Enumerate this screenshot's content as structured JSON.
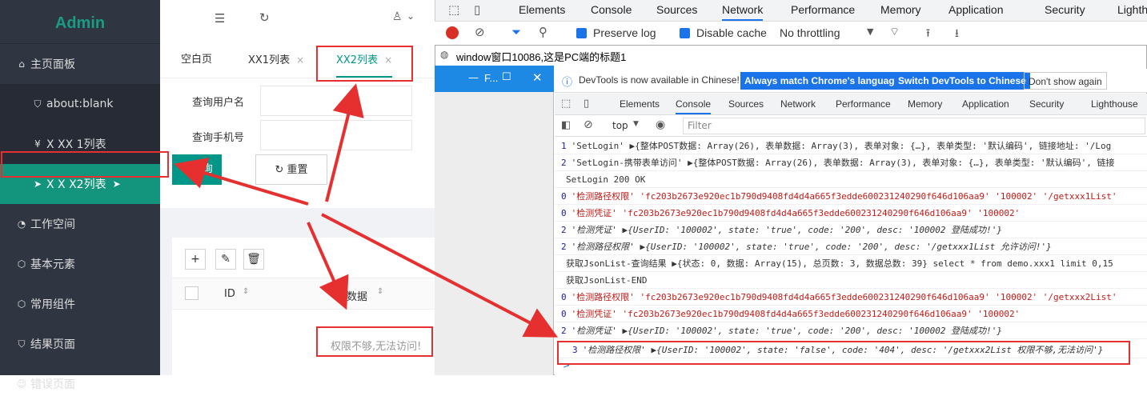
{
  "admin": {
    "brand": "Admin",
    "nav": [
      {
        "label": "主页面板",
        "icon": "home-icon"
      },
      {
        "label": "about:blank",
        "icon": "shield-icon"
      },
      {
        "label": "X XX 1列表",
        "icon": "yen-icon"
      },
      {
        "label": "X X X2列表",
        "icon": "send-icon",
        "active": true
      },
      {
        "label": "工作空间",
        "icon": "dashboard-icon"
      },
      {
        "label": "基本元素",
        "icon": "cube-icon"
      },
      {
        "label": "常用组件",
        "icon": "cube-icon"
      },
      {
        "label": "结果页面",
        "icon": "check-shield-icon"
      },
      {
        "label": "错误页面",
        "icon": "face-icon"
      }
    ],
    "tabs": [
      {
        "label": "空白页"
      },
      {
        "label": "XX1列表",
        "close": "×"
      },
      {
        "label": "XX2列表",
        "close": "×",
        "active": true
      }
    ],
    "form": {
      "user_label": "查询用户名",
      "phone_label": "查询手机号",
      "search_button": "查询",
      "reset_button": "重置"
    },
    "table": {
      "col_id": "ID",
      "col_data": "数据",
      "empty_message": "权限不够,无法访问!"
    },
    "accent": "#009688"
  },
  "devtools": {
    "tabs": [
      "Elements",
      "Console",
      "Sources",
      "Network",
      "Performance",
      "Memory",
      "Application",
      "Security",
      "Lighthouse"
    ],
    "active_tab": "Network",
    "network_toolbar": {
      "preserve_log": "Preserve log",
      "disable_cache": "Disable cache",
      "throttling": "No throttling"
    }
  },
  "popup": {
    "title": "window窗口10086,这是PC端的标题1",
    "left_window_title": "F...",
    "info_text": "DevTools is now available in Chinese!",
    "btn_match": "Always match Chrome's language",
    "btn_switch": "Switch DevTools to Chinese",
    "btn_dont_show": "Don't show again",
    "tabs": [
      "Elements",
      "Console",
      "Sources",
      "Network",
      "Performance",
      "Memory",
      "Application",
      "Security",
      "Lighthouse"
    ],
    "active_tab": "Console",
    "context": "top",
    "filter_placeholder": "Filter",
    "console_lines": [
      {
        "count": "1",
        "text": "'SetLogin' ▶{整体POST数据: Array(26), 表单数据: Array(3), 表单对象: {…}, 表单类型: '默认编码', 链接地址: '/Log"
      },
      {
        "count": "2",
        "text": "'SetLogin-携带表单访问' ▶{整体POST数据: Array(26), 表单数据: Array(3), 表单对象: {…}, 表单类型: '默认编码', 链接"
      },
      {
        "count": "",
        "text": "SetLogin 200 OK"
      },
      {
        "count": "0",
        "text": "'检测路径权限' 'fc203b2673e920ec1b790d9408fd4d4a665f3edde600231240290f646d106aa9' '100002' '/getxxx1List'"
      },
      {
        "count": "0",
        "text": "'检测凭证' 'fc203b2673e920ec1b790d9408fd4d4a665f3edde600231240290f646d106aa9' '100002'"
      },
      {
        "count": "2",
        "text": "'检测凭证' ▶{UserID: '100002', state: 'true', code: '200', desc: '100002 登陆成功!'}"
      },
      {
        "count": "2",
        "text": "'检测路径权限' ▶{UserID: '100002', state: 'true', code: '200', desc: '/getxxx1List 允许访问!'}"
      },
      {
        "count": "",
        "text": "获取JsonList-查询结果 ▶{状态: 0, 数据: Array(15), 总页数: 3, 数据总数: 39} select * from demo.xxx1 limit 0,15"
      },
      {
        "count": "",
        "text": "获取JsonList-END"
      },
      {
        "count": "0",
        "text": "'检测路径权限' 'fc203b2673e920ec1b790d9408fd4d4a665f3edde600231240290f646d106aa9' '100002' '/getxxx2List'"
      },
      {
        "count": "0",
        "text": "'检测凭证' 'fc203b2673e920ec1b790d9408fd4d4a665f3edde600231240290f646d106aa9' '100002'"
      },
      {
        "count": "2",
        "text": "'检测凭证' ▶{UserID: '100002', state: 'true', code: '200', desc: '100002 登陆成功!'}"
      },
      {
        "count": "3",
        "text": "'检测路径权限' ▶{UserID: '100002', state: 'false', code: '404', desc: '/getxxx2List 权限不够,无法访问'}"
      }
    ],
    "prompt": ">"
  },
  "annotation_color": "#e63030"
}
